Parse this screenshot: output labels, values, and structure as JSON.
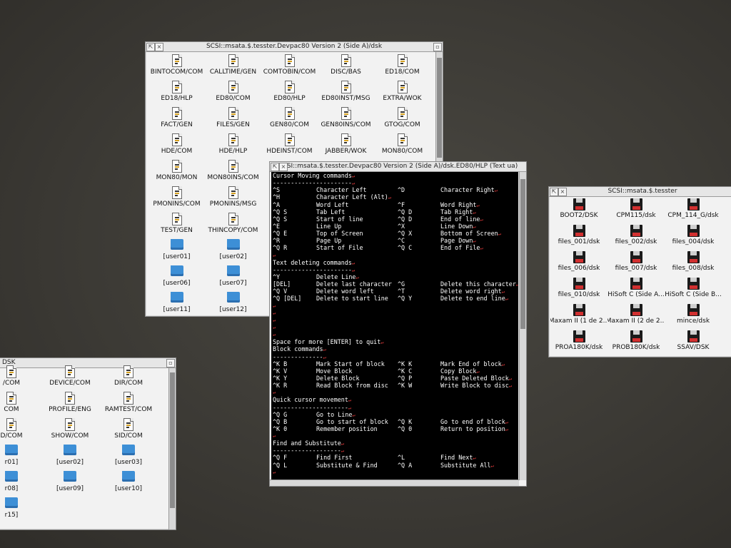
{
  "filer_main": {
    "title": "SCSI::msata.$.tesster.Devpac80 Version 2 (Side A)/dsk",
    "items": [
      {
        "label": "BINTOCOM/COM",
        "icon": "file-icon"
      },
      {
        "label": "CALLTIME/GEN",
        "icon": "file-icon"
      },
      {
        "label": "COMTOBIN/COM",
        "icon": "file-icon"
      },
      {
        "label": "DISC/BAS",
        "icon": "file-icon"
      },
      {
        "label": "ED18/COM",
        "icon": "file-icon"
      },
      {
        "label": "ED18/HLP",
        "icon": "file-icon"
      },
      {
        "label": "ED80/COM",
        "icon": "file-icon"
      },
      {
        "label": "ED80/HLP",
        "icon": "file-icon"
      },
      {
        "label": "ED80INST/MSG",
        "icon": "file-icon"
      },
      {
        "label": "EXTRA/WOK",
        "icon": "file-icon"
      },
      {
        "label": "FACT/GEN",
        "icon": "file-icon"
      },
      {
        "label": "FILES/GEN",
        "icon": "file-icon"
      },
      {
        "label": "GEN80/COM",
        "icon": "file-icon"
      },
      {
        "label": "GEN80INS/COM",
        "icon": "file-icon"
      },
      {
        "label": "GTOG/COM",
        "icon": "file-icon"
      },
      {
        "label": "HDE/COM",
        "icon": "file-icon"
      },
      {
        "label": "HDE/HLP",
        "icon": "file-icon"
      },
      {
        "label": "HDEINST/COM",
        "icon": "file-icon"
      },
      {
        "label": "JABBER/WOK",
        "icon": "file-icon"
      },
      {
        "label": "MON80/COM",
        "icon": "file-icon"
      },
      {
        "label": "MON80/MON",
        "icon": "file-icon"
      },
      {
        "label": "MON80INS/COM",
        "icon": "file-icon"
      },
      {
        "label": "",
        "icon": ""
      },
      {
        "label": "",
        "icon": ""
      },
      {
        "label": "",
        "icon": ""
      },
      {
        "label": "PMONINS/COM",
        "icon": "file-icon"
      },
      {
        "label": "PMONINS/MSG",
        "icon": "file-icon"
      },
      {
        "label": "",
        "icon": ""
      },
      {
        "label": "",
        "icon": ""
      },
      {
        "label": "",
        "icon": ""
      },
      {
        "label": "TEST/GEN",
        "icon": "file-icon"
      },
      {
        "label": "THINCOPY/COM",
        "icon": "file-icon"
      },
      {
        "label": "",
        "icon": ""
      },
      {
        "label": "",
        "icon": ""
      },
      {
        "label": "",
        "icon": ""
      },
      {
        "label": "[user01]",
        "icon": "folder-icon"
      },
      {
        "label": "[user02]",
        "icon": "folder-icon"
      },
      {
        "label": "",
        "icon": ""
      },
      {
        "label": "",
        "icon": ""
      },
      {
        "label": "",
        "icon": ""
      },
      {
        "label": "[user06]",
        "icon": "folder-icon"
      },
      {
        "label": "[user07]",
        "icon": "folder-icon"
      },
      {
        "label": "",
        "icon": ""
      },
      {
        "label": "",
        "icon": ""
      },
      {
        "label": "",
        "icon": ""
      },
      {
        "label": "[user11]",
        "icon": "folder-icon"
      },
      {
        "label": "[user12]",
        "icon": "folder-icon"
      }
    ]
  },
  "filer_tesster": {
    "title": "SCSI::msata.$.tesster",
    "items": [
      {
        "label": "BOOT2/DSK",
        "icon": "floppy-icon"
      },
      {
        "label": "CPM115/dsk",
        "icon": "floppy-icon"
      },
      {
        "label": "CPM_114_G/dsk",
        "icon": "floppy-icon"
      },
      {
        "label": "files_001/dsk",
        "icon": "floppy-icon"
      },
      {
        "label": "files_002/dsk",
        "icon": "floppy-icon"
      },
      {
        "label": "files_004/dsk",
        "icon": "floppy-icon"
      },
      {
        "label": "files_006/dsk",
        "icon": "floppy-icon"
      },
      {
        "label": "files_007/dsk",
        "icon": "floppy-icon"
      },
      {
        "label": "files_008/dsk",
        "icon": "floppy-icon"
      },
      {
        "label": "files_010/dsk",
        "icon": "floppy-icon"
      },
      {
        "label": "HiSoft C (Side A...",
        "icon": "floppy-icon"
      },
      {
        "label": "HiSoft C (Side B...",
        "icon": "floppy-icon"
      },
      {
        "label": "Maxam II (1 de 2...",
        "icon": "floppy-icon"
      },
      {
        "label": "Maxam II (2 de 2...",
        "icon": "floppy-icon"
      },
      {
        "label": "mince/dsk",
        "icon": "floppy-icon"
      },
      {
        "label": "PROA180K/dsk",
        "icon": "floppy-icon"
      },
      {
        "label": "PROB180K/dsk",
        "icon": "floppy-icon"
      },
      {
        "label": "SSAV/DSK",
        "icon": "floppy-icon"
      }
    ]
  },
  "filer_lower": {
    "title": "DSK",
    "items": [
      {
        "label": "/COM",
        "icon": "file-icon"
      },
      {
        "label": "DEVICE/COM",
        "icon": "file-icon"
      },
      {
        "label": "DIR/COM",
        "icon": "file-icon"
      },
      {
        "label": "COM",
        "icon": "file-icon"
      },
      {
        "label": "PROFILE/ENG",
        "icon": "file-icon"
      },
      {
        "label": "RAMTEST/COM",
        "icon": "file-icon"
      },
      {
        "label": "D/COM",
        "icon": "file-icon"
      },
      {
        "label": "SHOW/COM",
        "icon": "file-icon"
      },
      {
        "label": "SID/COM",
        "icon": "file-icon"
      },
      {
        "label": "r01]",
        "icon": "folder-icon"
      },
      {
        "label": "[user02]",
        "icon": "folder-icon"
      },
      {
        "label": "[user03]",
        "icon": "folder-icon"
      },
      {
        "label": "r08]",
        "icon": "folder-icon"
      },
      {
        "label": "[user09]",
        "icon": "folder-icon"
      },
      {
        "label": "[user10]",
        "icon": "folder-icon"
      },
      {
        "label": "r15]",
        "icon": "folder-icon"
      }
    ]
  },
  "text_window": {
    "title": "SCSI::msata.$.tesster.Devpac80 Version 2 (Side A)/dsk.ED80/HLP (Text ua)",
    "lines": [
      [
        "Cursor Moving commands",
        "",
        "",
        ""
      ],
      [
        "----------------------",
        "",
        "",
        ""
      ],
      [
        "^S",
        "Character Left",
        "^D",
        "Character Right"
      ],
      [
        "^H",
        "Character Left (Alt)",
        "",
        ""
      ],
      [
        "^A",
        "Word Left",
        "^F",
        "Word Right"
      ],
      [
        "^Q S",
        "Tab Left",
        "^Q D",
        "Tab Right"
      ],
      [
        "^Q S",
        "Start of line",
        "^Q D",
        "End of line"
      ],
      [
        "^E",
        "Line Up",
        "^X",
        "Line Down"
      ],
      [
        "^Q E",
        "Top of Screen",
        "^Q X",
        "Bottom of Screen"
      ],
      [
        "^R",
        "Page Up",
        "^C",
        "Page Down"
      ],
      [
        "^Q R",
        "Start of File",
        "^Q C",
        "End of File"
      ],
      [
        "",
        "",
        "",
        ""
      ],
      [
        "Text deleting commands",
        "",
        "",
        ""
      ],
      [
        "----------------------",
        "",
        "",
        ""
      ],
      [
        "^Y",
        "Delete Line",
        "",
        ""
      ],
      [
        "[DEL]",
        "Delete last character",
        "^G",
        "Delete this character"
      ],
      [
        "^Q V",
        "Delete word left",
        "^T",
        "Delete word right"
      ],
      [
        "^Q [DEL]",
        "Delete to start line",
        "^Q Y",
        "Delete to end line"
      ],
      [
        "",
        "",
        "",
        ""
      ],
      [
        "",
        "",
        "",
        ""
      ],
      [
        "",
        "",
        "",
        ""
      ],
      [
        "",
        "",
        "",
        ""
      ],
      [
        "",
        "",
        "",
        ""
      ],
      [
        "Space for more [ENTER] to quit",
        "",
        "",
        ""
      ],
      [
        "Block commands",
        "",
        "",
        ""
      ],
      [
        "--------------",
        "",
        "",
        ""
      ],
      [
        "^K B",
        "Mark Start of block",
        "^K K",
        "Mark End of block"
      ],
      [
        "^K V",
        "Move Block",
        "^K C",
        "Copy Block"
      ],
      [
        "^K Y",
        "Delete Block",
        "^Q P",
        "Paste Deleted Block"
      ],
      [
        "^K R",
        "Read Block from disc",
        "^K W",
        "Write Block to disc"
      ],
      [
        "",
        "",
        "",
        ""
      ],
      [
        "Quick cursor movement",
        "",
        "",
        ""
      ],
      [
        "---------------------",
        "",
        "",
        ""
      ],
      [
        "^Q G",
        "Go to Line",
        "",
        ""
      ],
      [
        "^Q B",
        "Go to start of block",
        "^Q K",
        "Go to end of block"
      ],
      [
        "^K 0",
        "Remember position",
        "^Q 0",
        "Return to position"
      ],
      [
        "",
        "",
        "",
        ""
      ],
      [
        "Find and Substitute",
        "",
        "",
        ""
      ],
      [
        "-------------------",
        "",
        "",
        ""
      ],
      [
        "^Q F",
        "Find First",
        "^L",
        "Find Next"
      ],
      [
        "^Q L",
        "Substitute & Find",
        "^Q A",
        "Substitute All"
      ],
      [
        "",
        "",
        "",
        ""
      ]
    ],
    "return_marker": "↵"
  }
}
